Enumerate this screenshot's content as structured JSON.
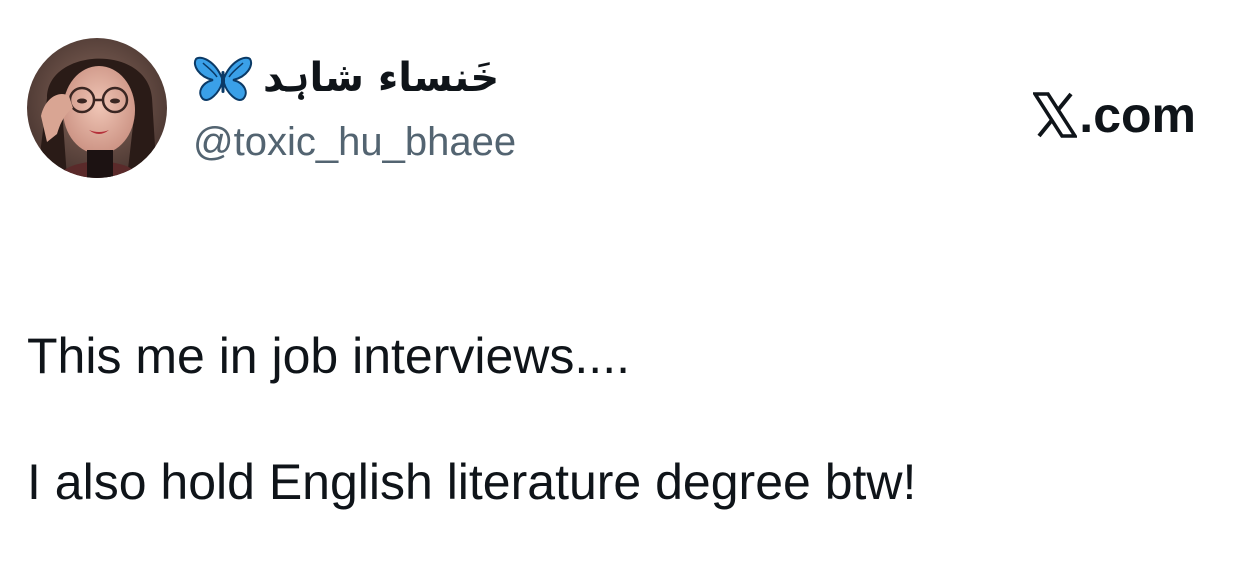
{
  "author": {
    "display_name": "خَنساء شاہد",
    "handle": "@toxic_hu_bhaee",
    "avatar": "profile-photo",
    "name_badge_icon": "butterfly-icon"
  },
  "brand": {
    "logo_icon": "x-logo-icon",
    "suffix": ".com"
  },
  "tweet": {
    "lines": [
      "This me in job interviews....",
      "I also hold English literature degree btw!"
    ]
  },
  "colors": {
    "text": "#0f1419",
    "secondary": "#536471",
    "butterfly": "#3aa0e8"
  }
}
